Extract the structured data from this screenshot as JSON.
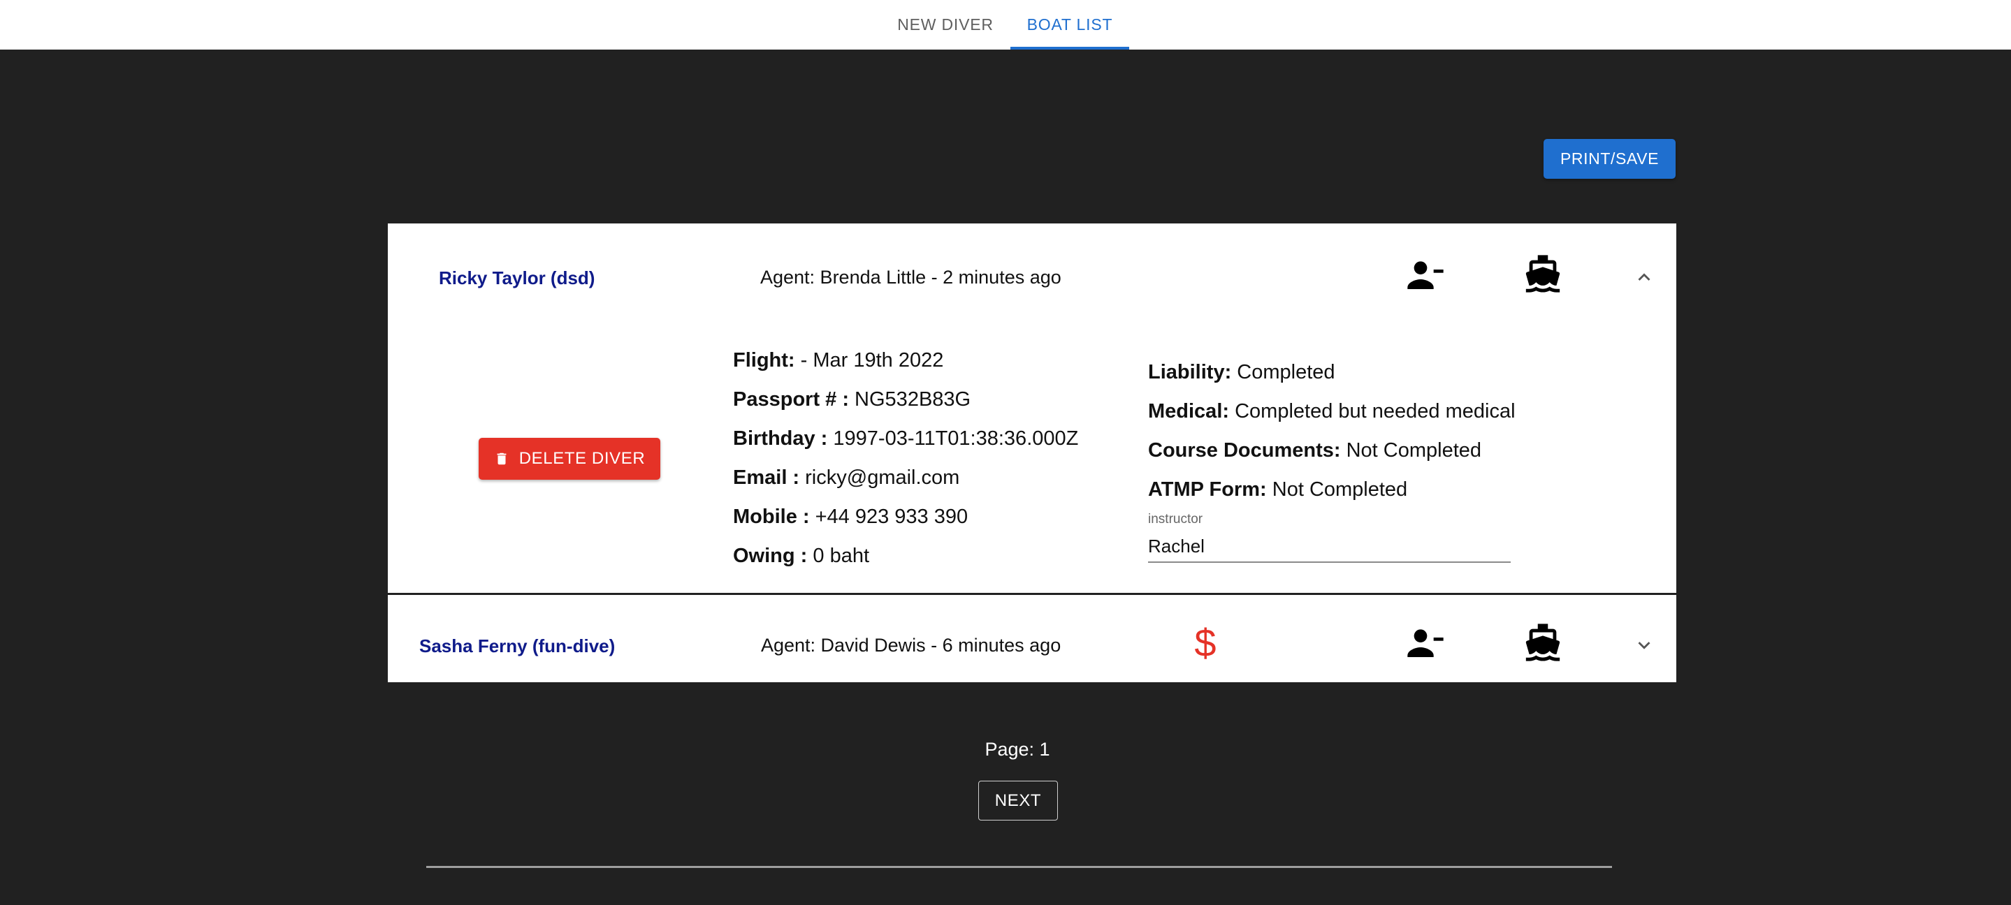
{
  "tabs": [
    {
      "label": "NEW DIVER",
      "active": false
    },
    {
      "label": "BOAT LIST",
      "active": true
    }
  ],
  "toolbar": {
    "print_label": "PRINT/SAVE"
  },
  "divers": [
    {
      "name": "Ricky Taylor (dsd)",
      "agent": "Agent: Brenda Little - 2 minutes ago",
      "expanded": true,
      "icons": [
        "remove-person-icon",
        "boat-icon",
        "chevron-up-icon"
      ],
      "delete_label": "DELETE DIVER",
      "details": [
        {
          "label": "Flight:",
          "value": " - Mar 19th 2022"
        },
        {
          "label": "Passport # :",
          "value": " NG532B83G"
        },
        {
          "label": "Birthday :",
          "value": " 1997-03-11T01:38:36.000Z"
        },
        {
          "label": "Email :",
          "value": " ricky@gmail.com"
        },
        {
          "label": "Mobile :",
          "value": " +44 923 933 390"
        },
        {
          "label": "Owing :",
          "value": " 0 baht"
        }
      ],
      "documents": [
        {
          "label": "Liability:",
          "value": " Completed"
        },
        {
          "label": "Medical:",
          "value": " Completed but needed medical"
        },
        {
          "label": "Course Documents:",
          "value": " Not Completed"
        },
        {
          "label": "ATMP Form:",
          "value": " Not Completed"
        }
      ],
      "instructor": {
        "label": "instructor",
        "value": "Rachel"
      }
    },
    {
      "name": "Sasha Ferny (fun-dive)",
      "agent": "Agent: David Dewis - 6 minutes ago",
      "expanded": false,
      "icons": [
        "dollar-icon",
        "remove-person-icon",
        "boat-icon",
        "chevron-down-icon"
      ]
    }
  ],
  "pagination": {
    "page_label": "Page: 1",
    "next_label": "NEXT"
  },
  "colors": {
    "background": "#212121",
    "primary": "#1f6fcf",
    "danger": "#e53227",
    "name_text": "#0f1b8a"
  }
}
